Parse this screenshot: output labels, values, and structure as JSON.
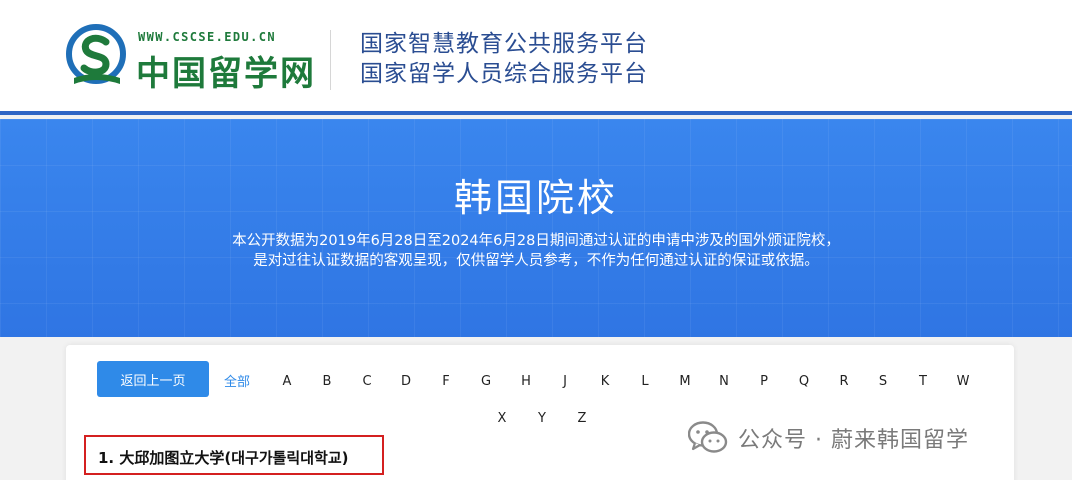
{
  "header": {
    "logo": {
      "url": "WWW.CSCSE.EDU.CN",
      "name": "中国留学网"
    },
    "platform_lines": [
      "国家智慧教育公共服务平台",
      "国家留学人员综合服务平台"
    ]
  },
  "banner": {
    "title": "韩国院校",
    "description_lines": [
      "本公开数据为2019年6月28日至2024年6月28日期间通过认证的申请中涉及的国外颁证院校，",
      "是对过往认证数据的客观呈现，仅供留学人员参考，不作为任何通过认证的保证或依据。"
    ]
  },
  "filter": {
    "back_label": "返回上一页",
    "all_label": "全部",
    "letters": [
      "A",
      "B",
      "C",
      "D",
      "F",
      "G",
      "H",
      "J",
      "K",
      "L",
      "M",
      "N",
      "P",
      "Q",
      "R",
      "S",
      "T",
      "W",
      "X",
      "Y",
      "Z"
    ]
  },
  "results": [
    {
      "index": "1.",
      "name": "大邱加图立大学(대구가톨릭대학교)"
    }
  ],
  "watermark": {
    "text": "公众号 · 蔚来韩国留学"
  },
  "colors": {
    "brand_green": "#1e7a3b",
    "platform_blue": "#2a4d92",
    "banner_blue": "#3a86ee",
    "button_blue": "#2f8ae8",
    "highlight_red": "#d42020"
  }
}
